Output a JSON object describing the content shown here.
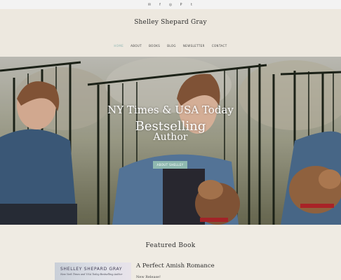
{
  "social_icons": [
    "email-icon",
    "facebook-icon",
    "instagram-icon",
    "pinterest-icon",
    "twitter-icon"
  ],
  "social_glyphs": [
    "✉",
    "f",
    "◎",
    "P",
    "t"
  ],
  "site": {
    "title": "Shelley Shepard Gray"
  },
  "nav": {
    "items": [
      "HOME",
      "ABOUT",
      "BOOKS",
      "BLOG",
      "NEWSLETTER",
      "CONTACT"
    ],
    "active": "HOME"
  },
  "hero": {
    "line1": "NY Times & USA Today",
    "line2": "Bestselling",
    "line3": "Author",
    "button": "ABOUT SHELLEY"
  },
  "featured": {
    "heading": "Featured Book",
    "cover_author": "SHELLEY SHEPARD GRAY",
    "cover_tagline": "New York Times and USA Today Bestselling Author",
    "title": "A Perfect Amish Romance",
    "subtitle": "New Release!"
  },
  "colors": {
    "accent": "#8fb9b0",
    "background": "#efebe3"
  }
}
